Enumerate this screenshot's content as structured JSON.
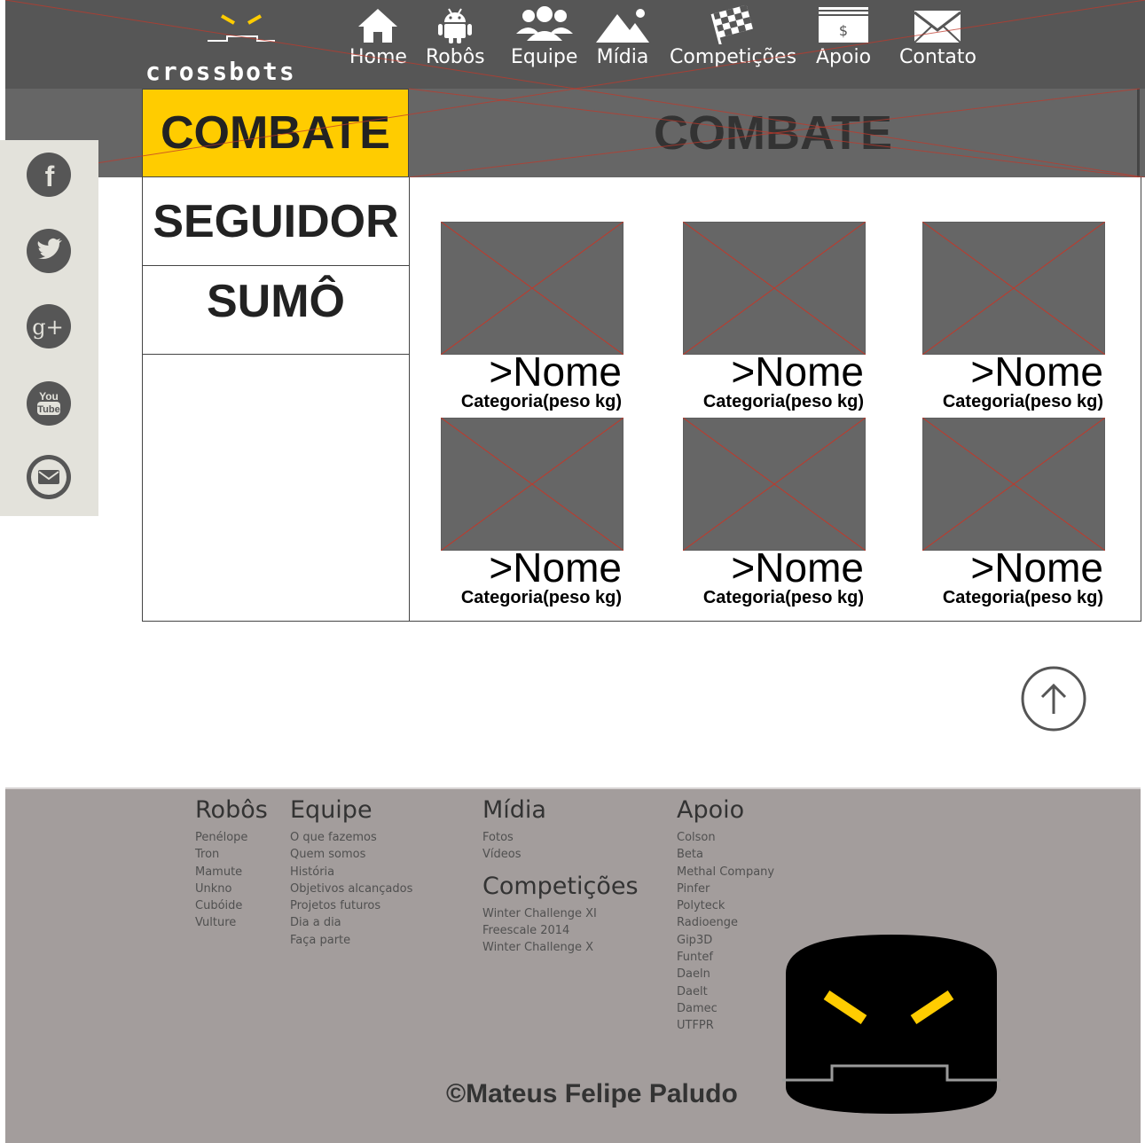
{
  "brand": {
    "name": "crossbots"
  },
  "nav": {
    "items": [
      {
        "label": "Home",
        "icon": "home-icon"
      },
      {
        "label": "Robôs",
        "icon": "android-icon"
      },
      {
        "label": "Equipe",
        "icon": "team-icon"
      },
      {
        "label": "Mídia",
        "icon": "mountain-icon"
      },
      {
        "label": "Competições",
        "icon": "checkered-flag-icon"
      },
      {
        "label": "Apoio",
        "icon": "money-icon",
        "icon_text": "$"
      },
      {
        "label": "Contato",
        "icon": "envelope-icon"
      }
    ]
  },
  "hero": {
    "active_category": "COMBATE",
    "title": "COMBATE"
  },
  "social": {
    "items": [
      {
        "icon": "facebook-icon",
        "glyph": "f"
      },
      {
        "icon": "twitter-icon"
      },
      {
        "icon": "google-plus-icon",
        "glyph": "g+"
      },
      {
        "icon": "youtube-icon",
        "glyph_top": "You",
        "glyph_bottom": "Tube"
      },
      {
        "icon": "email-icon"
      }
    ]
  },
  "categories": [
    {
      "label": "SEGUIDOR"
    },
    {
      "label": "SUMÔ"
    }
  ],
  "robots": [
    {
      "name": ">Nome",
      "category": "Categoria(peso kg)"
    },
    {
      "name": ">Nome",
      "category": "Categoria(peso kg)"
    },
    {
      "name": ">Nome",
      "category": "Categoria(peso kg)"
    },
    {
      "name": ">Nome",
      "category": "Categoria(peso kg)"
    },
    {
      "name": ">Nome",
      "category": "Categoria(peso kg)"
    },
    {
      "name": ">Nome",
      "category": "Categoria(peso kg)"
    }
  ],
  "footer": {
    "robos": {
      "title": "Robôs",
      "links": [
        "Penélope",
        "Tron",
        "Mamute",
        "Unkno",
        "Cubóide",
        "Vulture"
      ]
    },
    "equipe": {
      "title": "Equipe",
      "links": [
        "O que fazemos",
        "Quem somos",
        "História",
        "Objetivos alcançados",
        "Projetos futuros",
        "Dia a dia",
        "Faça parte"
      ]
    },
    "midia": {
      "title": "Mídia",
      "links": [
        "Fotos",
        "Vídeos"
      ]
    },
    "competicoes": {
      "title": "Competições",
      "links": [
        "Winter Challenge XI",
        "Freescale 2014",
        "Winter Challenge X"
      ]
    },
    "apoio": {
      "title": "Apoio",
      "links": [
        "Colson",
        "Beta",
        "Methal Company",
        "Pinfer",
        "Polyteck",
        "Radioenge",
        "Gip3D",
        "Funtef",
        "Daeln",
        "Daelt",
        "Damec",
        "UTFPR"
      ]
    },
    "copyright": "©Mateus Felipe Paludo"
  },
  "colors": {
    "header_bg": "#565656",
    "accent_yellow": "#ffcc00",
    "placeholder_gray": "#666666",
    "wireframe_red": "#c0392b",
    "footer_bg": "#a39d9c",
    "social_bg": "#e3e2db"
  }
}
